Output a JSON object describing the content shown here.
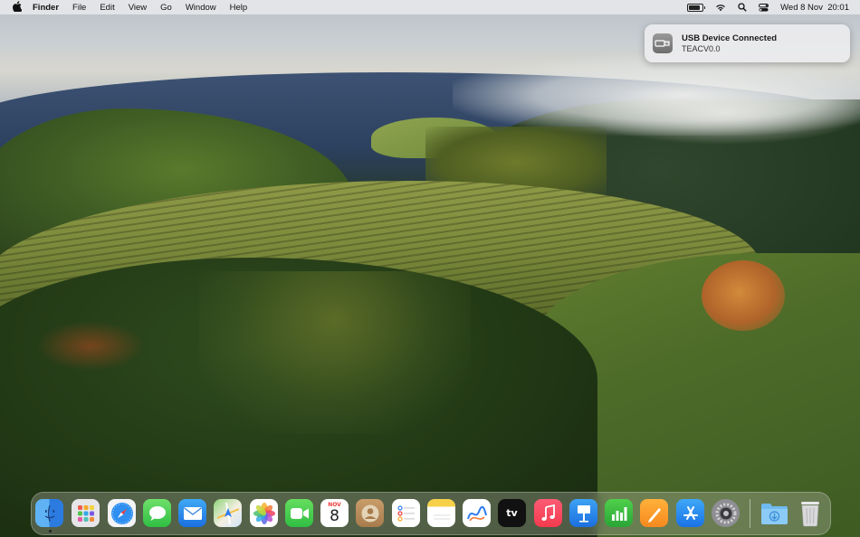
{
  "menubar": {
    "apple_icon": "apple-logo-icon",
    "app_name": "Finder",
    "menus": [
      "File",
      "Edit",
      "View",
      "Go",
      "Window",
      "Help"
    ],
    "battery_level": 0.85,
    "datetime": "Wed 8 Nov  20:01"
  },
  "notification": {
    "title": "USB Device Connected",
    "body": "TEACV0.0",
    "icon": "usb-icon"
  },
  "dock": {
    "apps": [
      {
        "name": "Finder",
        "icon": "finder-icon",
        "running": true
      },
      {
        "name": "Launchpad",
        "icon": "launchpad-icon"
      },
      {
        "name": "Safari",
        "icon": "safari-icon"
      },
      {
        "name": "Messages",
        "icon": "messages-icon"
      },
      {
        "name": "Mail",
        "icon": "mail-icon"
      },
      {
        "name": "Maps",
        "icon": "maps-icon"
      },
      {
        "name": "Photos",
        "icon": "photos-icon"
      },
      {
        "name": "FaceTime",
        "icon": "facetime-icon"
      },
      {
        "name": "Calendar",
        "icon": "calendar-icon",
        "month": "NOV",
        "day": "8"
      },
      {
        "name": "Contacts",
        "icon": "contacts-icon"
      },
      {
        "name": "Reminders",
        "icon": "reminders-icon"
      },
      {
        "name": "Notes",
        "icon": "notes-icon"
      },
      {
        "name": "Freeform",
        "icon": "freeform-icon"
      },
      {
        "name": "TV",
        "icon": "appletv-icon",
        "label": "tv"
      },
      {
        "name": "Music",
        "icon": "music-icon"
      },
      {
        "name": "Keynote",
        "icon": "keynote-icon"
      },
      {
        "name": "Numbers",
        "icon": "numbers-icon"
      },
      {
        "name": "Pages",
        "icon": "pages-icon"
      },
      {
        "name": "App Store",
        "icon": "appstore-icon"
      },
      {
        "name": "System Settings",
        "icon": "settings-icon"
      }
    ],
    "extras": [
      {
        "name": "Downloads",
        "icon": "downloads-folder-icon"
      },
      {
        "name": "Trash",
        "icon": "trash-icon"
      }
    ]
  }
}
